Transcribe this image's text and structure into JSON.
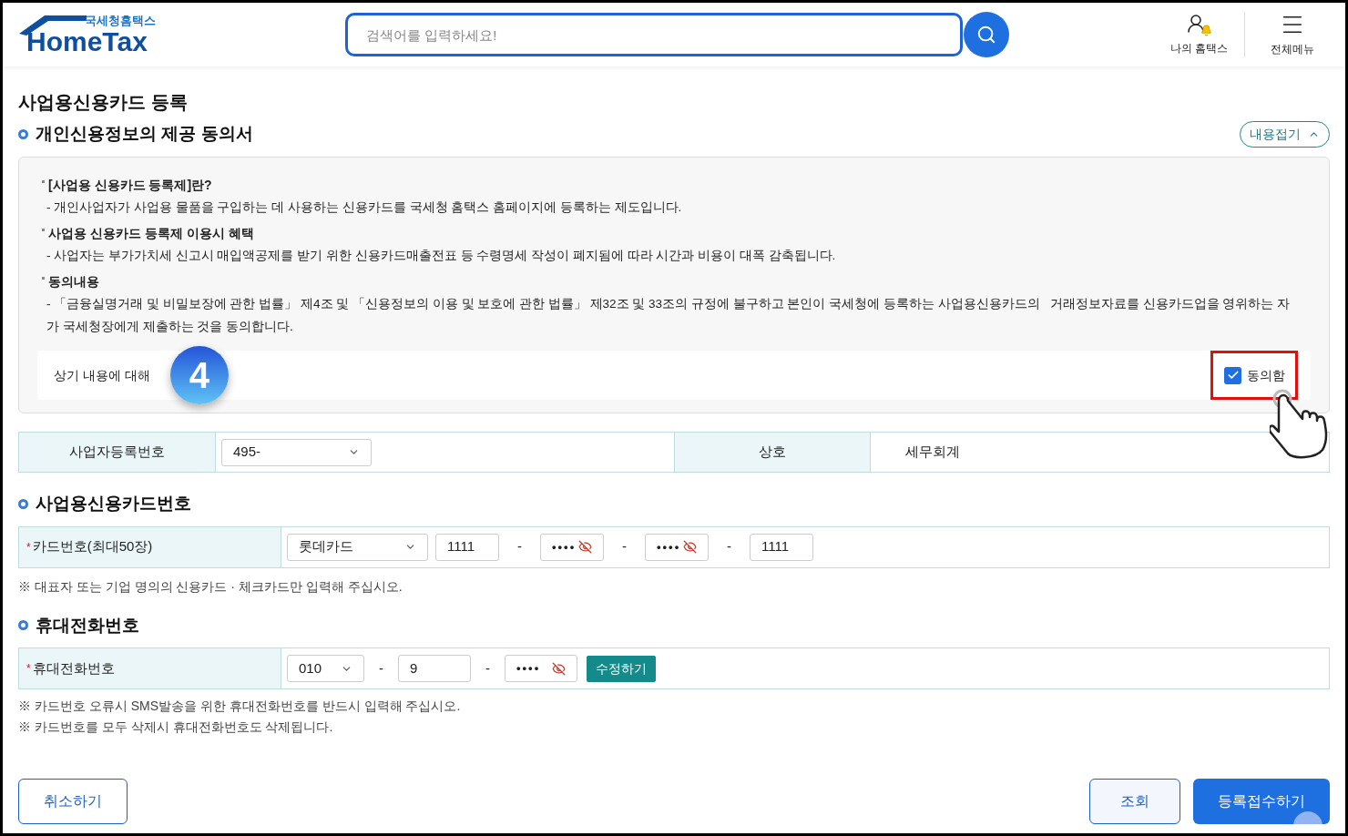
{
  "header": {
    "logo": {
      "small": "국세청홈택스",
      "large": "HomeTax"
    },
    "search": {
      "placeholder": "검색어를 입력하세요!"
    },
    "nav": [
      {
        "label": "나의 홈택스",
        "kind": "user"
      },
      {
        "label": "전체메뉴",
        "kind": "menu"
      }
    ]
  },
  "page_title": "사업용신용카드 등록",
  "consent": {
    "heading": "개인신용정보의 제공 동의서",
    "toggle": "내용접기",
    "expanded": true,
    "items": [
      {
        "title": "[사업용 신용카드 등록제]란?",
        "body": "- 개인사업자가 사업용 물품을 구입하는 데 사용하는 신용카드를 국세청 홈택스 홈페이지에 등록하는 제도입니다."
      },
      {
        "title": "사업용 신용카드 등록제 이용시 혜택",
        "body": "- 사업자는 부가가치세 신고시 매입액공제를 받기 위한 신용카드매출전표 등 수령명세 작성이 폐지됨에 따라 시간과 비용이 대폭 감축됩니다."
      },
      {
        "title": "동의내용",
        "body": "- 「금융실명거래 및 비밀보장에 관한 법률」 제4조 및 「신용정보의 이용 및 보호에 관한 법률」 제32조 및 33조의 규정에 불구하고 본인이 국세청에 등록하는 사업용신용카드의   거래정보자료를 신용카드업을 영위하는 자가 국세청장에게 제출하는 것을 동의합니다."
      }
    ],
    "agree_label": "상기 내용에 대해",
    "step": "4",
    "agree": {
      "label": "동의함",
      "checked": true
    }
  },
  "business": [
    {
      "label": "사업자등록번호",
      "value": "495-",
      "kind": "select"
    },
    {
      "label": "상호",
      "value": "세무회계",
      "kind": "text"
    }
  ],
  "card": {
    "heading": "사업용신용카드번호",
    "mark": "*",
    "label": "카드번호(최대50장)",
    "company": "롯데카드",
    "separator": "-",
    "parts": [
      {
        "value": "1111",
        "masked": false
      },
      {
        "value": "••••",
        "masked": true
      },
      {
        "value": "••••",
        "masked": true
      },
      {
        "value": "1111",
        "masked": false
      }
    ],
    "note": "※ 대표자 또는 기업 명의의 신용카드 · 체크카드만 입력해 주십시오."
  },
  "phone": {
    "heading": "휴대전화번호",
    "mark": "*",
    "label": "휴대전화번호",
    "prefix": "010",
    "separator": "-",
    "parts": [
      {
        "value": "9",
        "masked": false
      },
      {
        "value": "••••",
        "masked": true
      }
    ],
    "edit_button": "수정하기",
    "notes": [
      "※ 카드번호 오류시 SMS발송을 위한 휴대전화번호를 반드시 입력해 주십시오.",
      "※ 카드번호를 모두 삭제시 휴대전화번호도 삭제됩니다."
    ]
  },
  "buttons": [
    {
      "label": "취소하기",
      "kind": "outline"
    },
    {
      "label": "조회",
      "kind": "secondary"
    },
    {
      "label": "등록접수하기",
      "kind": "primary"
    }
  ]
}
